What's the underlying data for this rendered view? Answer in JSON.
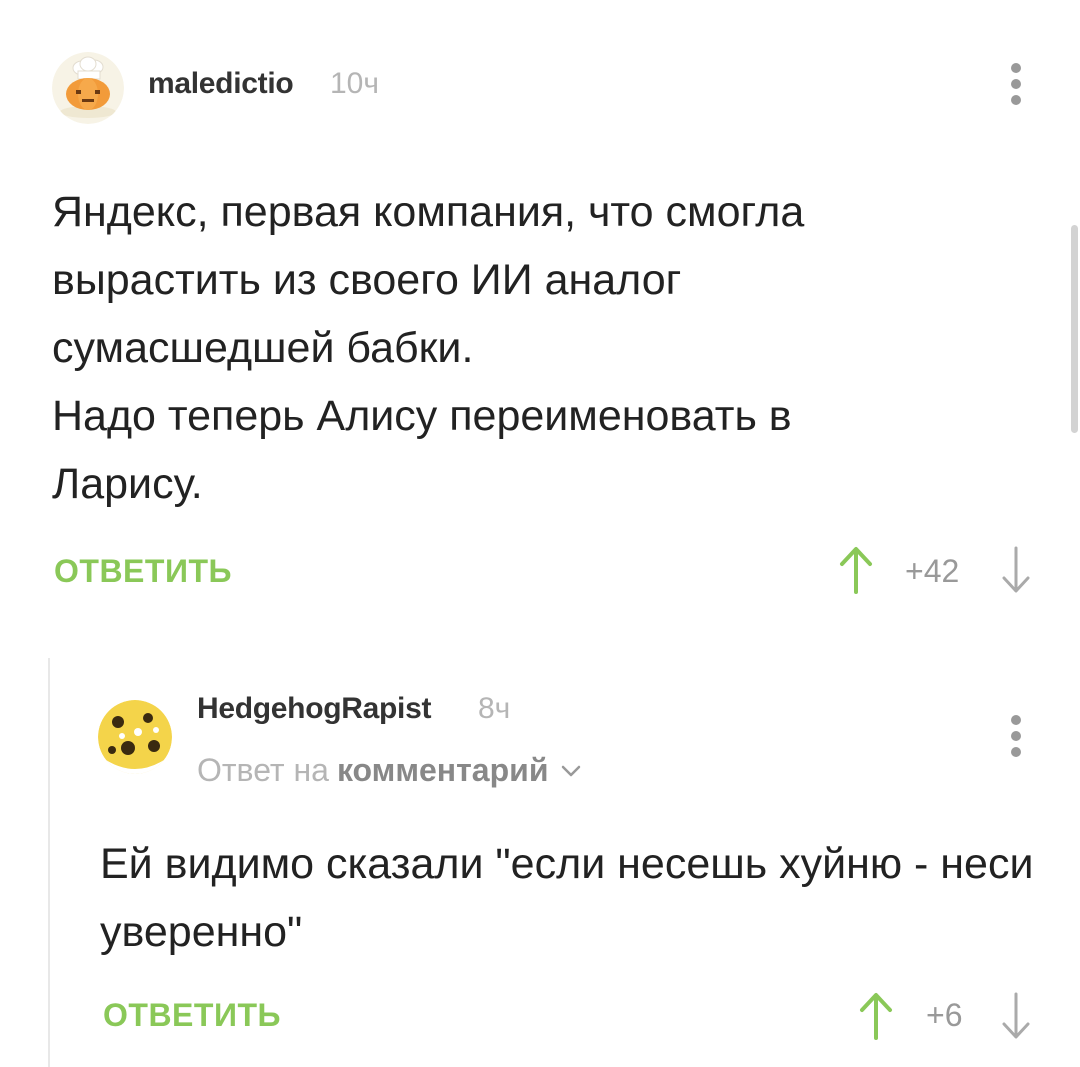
{
  "comments": [
    {
      "author": "maledictio",
      "time": "10ч",
      "body": [
        "Яндекс, первая компания, что смогла вырастить из своего ИИ аналог сумасшедшей бабки.",
        "Надо теперь Алису переименовать в Ларису."
      ],
      "reply_label": "ОТВЕТИТЬ",
      "score": "+42",
      "avatar_icon": "pumpkin-chef-avatar"
    },
    {
      "author": "HedgehogRapist",
      "time": "8ч",
      "reply_to_prefix": "Ответ на",
      "reply_to_target": "комментарий",
      "body": [
        "Ей видимо сказали \"если несешь хуйню - неси уверенно\""
      ],
      "reply_label": "ОТВЕТИТЬ",
      "score": "+6",
      "avatar_icon": "yellow-pattern-avatar"
    }
  ],
  "colors": {
    "accent_green": "#8ac858",
    "muted_text": "#b5b5b5",
    "body_text": "#222222"
  }
}
